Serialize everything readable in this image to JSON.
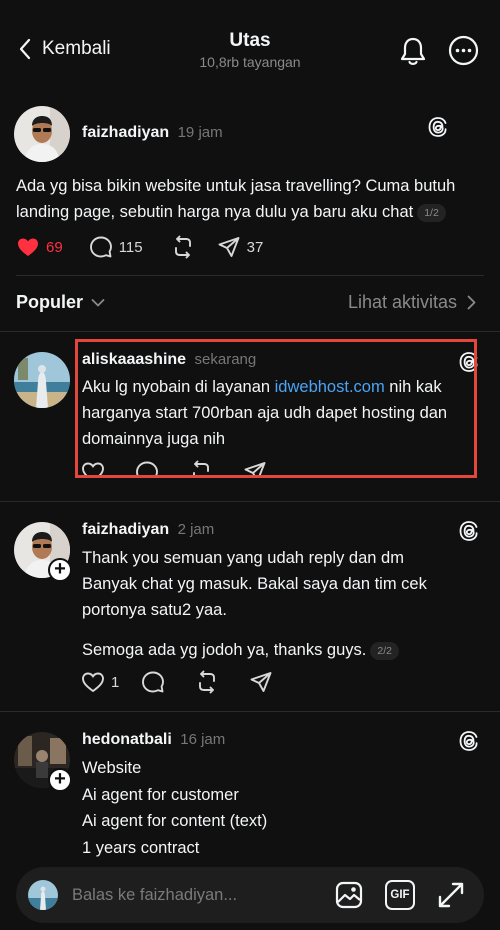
{
  "header": {
    "back_label": "Kembali",
    "title": "Utas",
    "subtitle": "10,8rb tayangan"
  },
  "main_post": {
    "username": "faizhadiyan",
    "time": "19 jam",
    "text": "Ada yg bisa bikin website untuk jasa travelling? Cuma butuh landing page, sebutin harga nya dulu ya baru aku chat",
    "page_indicator": "1/2",
    "likes": "69",
    "comments": "115",
    "shares": "37",
    "like_color": "#ff3040"
  },
  "sort": {
    "label": "Populer",
    "activity_label": "Lihat aktivitas"
  },
  "replies": [
    {
      "username": "aliskaaashine",
      "time": "sekarang",
      "text_before": "Aku lg nyobain di layanan ",
      "link": "idwebhost.com",
      "text_after": " nih kak harganya start 700rban aja udh dapet hosting dan domainnya juga nih",
      "highlight_color": "#e3473b"
    },
    {
      "username": "faizhadiyan",
      "time": "2 jam",
      "lines": [
        "Thank you semuan yang udah reply dan dm",
        "Banyak chat yg masuk. Bakal saya dan tim cek",
        "portonya satu2 yaa."
      ],
      "last_line": "Semoga ada yg jodoh ya, thanks guys.",
      "page_indicator": "2/2",
      "likes": "1"
    },
    {
      "username": "hedonatbali",
      "time": "16 jam",
      "lines": [
        "Website",
        "Ai agent for customer",
        "Ai agent for content (text)",
        "1 years contract"
      ]
    }
  ],
  "reply_bar": {
    "placeholder": "Balas ke faizhadiyan...",
    "gif_label": "GIF"
  },
  "icons": [
    "chevron-left-icon",
    "bell-icon",
    "more-icon",
    "threads-icon",
    "heart-icon",
    "comment-icon",
    "repost-icon",
    "share-icon",
    "chevron-down-icon",
    "chevron-right-icon",
    "plus-icon",
    "image-icon",
    "gif-icon",
    "expand-icon"
  ]
}
